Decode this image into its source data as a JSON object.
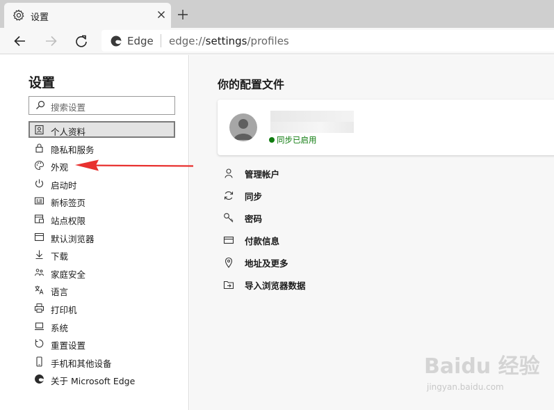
{
  "tab": {
    "title": "设置",
    "icon": "gear-icon"
  },
  "address_bar": {
    "site_label": "Edge",
    "url_prefix": "edge://",
    "url_path": "settings",
    "url_suffix": "/profiles"
  },
  "sidebar": {
    "heading": "设置",
    "search_placeholder": "搜索设置",
    "items": [
      {
        "label": "个人资料",
        "icon": "profile-icon",
        "active": true
      },
      {
        "label": "隐私和服务",
        "icon": "lock-icon"
      },
      {
        "label": "外观",
        "icon": "palette-icon"
      },
      {
        "label": "启动时",
        "icon": "power-icon"
      },
      {
        "label": "新标签页",
        "icon": "new-tab-icon"
      },
      {
        "label": "站点权限",
        "icon": "site-permissions-icon"
      },
      {
        "label": "默认浏览器",
        "icon": "browser-icon"
      },
      {
        "label": "下载",
        "icon": "download-icon"
      },
      {
        "label": "家庭安全",
        "icon": "family-icon"
      },
      {
        "label": "语言",
        "icon": "language-icon"
      },
      {
        "label": "打印机",
        "icon": "printer-icon"
      },
      {
        "label": "系统",
        "icon": "laptop-icon"
      },
      {
        "label": "重置设置",
        "icon": "reset-icon"
      },
      {
        "label": "手机和其他设备",
        "icon": "phone-icon"
      },
      {
        "label": "关于 Microsoft Edge",
        "icon": "edge-icon"
      }
    ]
  },
  "main": {
    "title": "你的配置文件",
    "profile": {
      "sync_status": "同步已启用"
    },
    "menu": [
      {
        "label": "管理帐户",
        "icon": "person-icon"
      },
      {
        "label": "同步",
        "icon": "sync-icon"
      },
      {
        "label": "密码",
        "icon": "key-icon"
      },
      {
        "label": "付款信息",
        "icon": "card-icon"
      },
      {
        "label": "地址及更多",
        "icon": "location-icon"
      },
      {
        "label": "导入浏览器数据",
        "icon": "import-icon"
      }
    ]
  },
  "watermark": {
    "brand": "Baidu 经验",
    "url": "jingyan.baidu.com"
  },
  "colors": {
    "sync_green": "#107c10",
    "annotation_arrow": "#e8312f",
    "sidebar_bg": "#ffffff",
    "main_bg": "#f7f7f7"
  }
}
